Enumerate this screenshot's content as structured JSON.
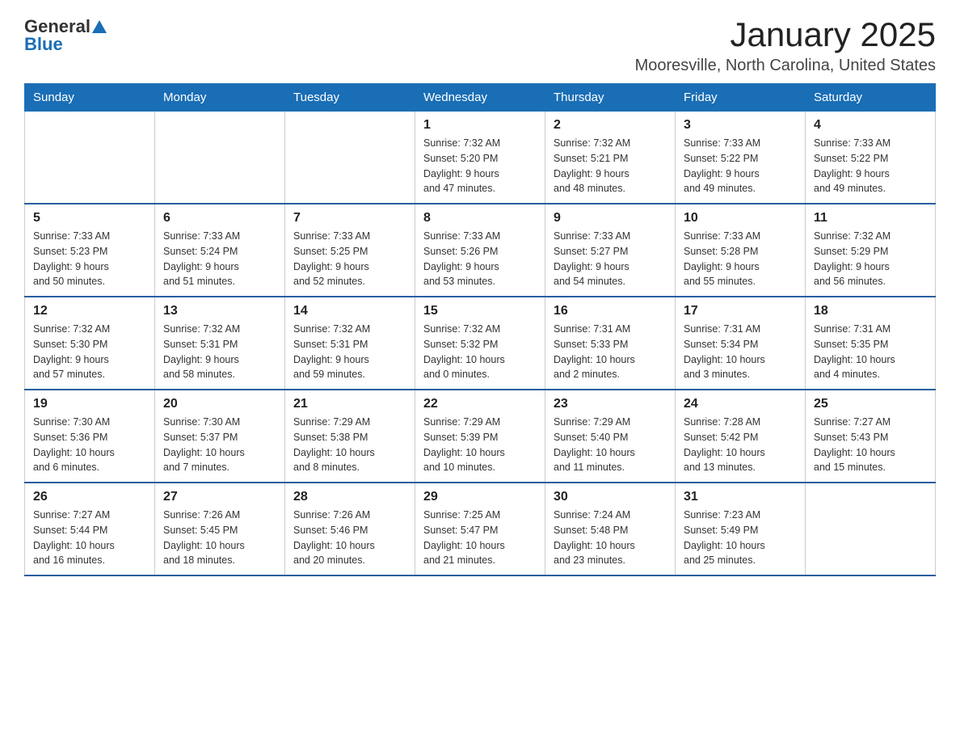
{
  "logo": {
    "text_general": "General",
    "text_blue": "Blue"
  },
  "header": {
    "month": "January 2025",
    "location": "Mooresville, North Carolina, United States"
  },
  "days_of_week": [
    "Sunday",
    "Monday",
    "Tuesday",
    "Wednesday",
    "Thursday",
    "Friday",
    "Saturday"
  ],
  "weeks": [
    [
      {
        "day": "",
        "info": ""
      },
      {
        "day": "",
        "info": ""
      },
      {
        "day": "",
        "info": ""
      },
      {
        "day": "1",
        "info": "Sunrise: 7:32 AM\nSunset: 5:20 PM\nDaylight: 9 hours\nand 47 minutes."
      },
      {
        "day": "2",
        "info": "Sunrise: 7:32 AM\nSunset: 5:21 PM\nDaylight: 9 hours\nand 48 minutes."
      },
      {
        "day": "3",
        "info": "Sunrise: 7:33 AM\nSunset: 5:22 PM\nDaylight: 9 hours\nand 49 minutes."
      },
      {
        "day": "4",
        "info": "Sunrise: 7:33 AM\nSunset: 5:22 PM\nDaylight: 9 hours\nand 49 minutes."
      }
    ],
    [
      {
        "day": "5",
        "info": "Sunrise: 7:33 AM\nSunset: 5:23 PM\nDaylight: 9 hours\nand 50 minutes."
      },
      {
        "day": "6",
        "info": "Sunrise: 7:33 AM\nSunset: 5:24 PM\nDaylight: 9 hours\nand 51 minutes."
      },
      {
        "day": "7",
        "info": "Sunrise: 7:33 AM\nSunset: 5:25 PM\nDaylight: 9 hours\nand 52 minutes."
      },
      {
        "day": "8",
        "info": "Sunrise: 7:33 AM\nSunset: 5:26 PM\nDaylight: 9 hours\nand 53 minutes."
      },
      {
        "day": "9",
        "info": "Sunrise: 7:33 AM\nSunset: 5:27 PM\nDaylight: 9 hours\nand 54 minutes."
      },
      {
        "day": "10",
        "info": "Sunrise: 7:33 AM\nSunset: 5:28 PM\nDaylight: 9 hours\nand 55 minutes."
      },
      {
        "day": "11",
        "info": "Sunrise: 7:32 AM\nSunset: 5:29 PM\nDaylight: 9 hours\nand 56 minutes."
      }
    ],
    [
      {
        "day": "12",
        "info": "Sunrise: 7:32 AM\nSunset: 5:30 PM\nDaylight: 9 hours\nand 57 minutes."
      },
      {
        "day": "13",
        "info": "Sunrise: 7:32 AM\nSunset: 5:31 PM\nDaylight: 9 hours\nand 58 minutes."
      },
      {
        "day": "14",
        "info": "Sunrise: 7:32 AM\nSunset: 5:31 PM\nDaylight: 9 hours\nand 59 minutes."
      },
      {
        "day": "15",
        "info": "Sunrise: 7:32 AM\nSunset: 5:32 PM\nDaylight: 10 hours\nand 0 minutes."
      },
      {
        "day": "16",
        "info": "Sunrise: 7:31 AM\nSunset: 5:33 PM\nDaylight: 10 hours\nand 2 minutes."
      },
      {
        "day": "17",
        "info": "Sunrise: 7:31 AM\nSunset: 5:34 PM\nDaylight: 10 hours\nand 3 minutes."
      },
      {
        "day": "18",
        "info": "Sunrise: 7:31 AM\nSunset: 5:35 PM\nDaylight: 10 hours\nand 4 minutes."
      }
    ],
    [
      {
        "day": "19",
        "info": "Sunrise: 7:30 AM\nSunset: 5:36 PM\nDaylight: 10 hours\nand 6 minutes."
      },
      {
        "day": "20",
        "info": "Sunrise: 7:30 AM\nSunset: 5:37 PM\nDaylight: 10 hours\nand 7 minutes."
      },
      {
        "day": "21",
        "info": "Sunrise: 7:29 AM\nSunset: 5:38 PM\nDaylight: 10 hours\nand 8 minutes."
      },
      {
        "day": "22",
        "info": "Sunrise: 7:29 AM\nSunset: 5:39 PM\nDaylight: 10 hours\nand 10 minutes."
      },
      {
        "day": "23",
        "info": "Sunrise: 7:29 AM\nSunset: 5:40 PM\nDaylight: 10 hours\nand 11 minutes."
      },
      {
        "day": "24",
        "info": "Sunrise: 7:28 AM\nSunset: 5:42 PM\nDaylight: 10 hours\nand 13 minutes."
      },
      {
        "day": "25",
        "info": "Sunrise: 7:27 AM\nSunset: 5:43 PM\nDaylight: 10 hours\nand 15 minutes."
      }
    ],
    [
      {
        "day": "26",
        "info": "Sunrise: 7:27 AM\nSunset: 5:44 PM\nDaylight: 10 hours\nand 16 minutes."
      },
      {
        "day": "27",
        "info": "Sunrise: 7:26 AM\nSunset: 5:45 PM\nDaylight: 10 hours\nand 18 minutes."
      },
      {
        "day": "28",
        "info": "Sunrise: 7:26 AM\nSunset: 5:46 PM\nDaylight: 10 hours\nand 20 minutes."
      },
      {
        "day": "29",
        "info": "Sunrise: 7:25 AM\nSunset: 5:47 PM\nDaylight: 10 hours\nand 21 minutes."
      },
      {
        "day": "30",
        "info": "Sunrise: 7:24 AM\nSunset: 5:48 PM\nDaylight: 10 hours\nand 23 minutes."
      },
      {
        "day": "31",
        "info": "Sunrise: 7:23 AM\nSunset: 5:49 PM\nDaylight: 10 hours\nand 25 minutes."
      },
      {
        "day": "",
        "info": ""
      }
    ]
  ]
}
